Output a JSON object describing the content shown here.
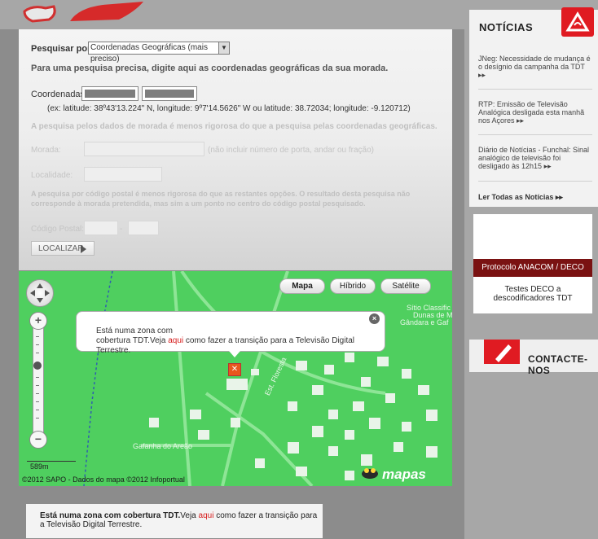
{
  "search": {
    "label": "Pesquisar por",
    "mode_value": "Coordenadas Geográficas (mais preciso)",
    "intro": "Para uma pesquisa precisa, digite aqui as coordenadas geográficas da sua morada.",
    "coords_label": "Coordenadas:",
    "coords_example": "(ex: latitude: 38º43'13.224\" N, longitude: 9º7'14.5626\" W ou latitude: 38.72034; longitude: -9.120712)",
    "address_note": "A pesquisa pelos dados de morada é menos rigorosa do que a pesquisa pelas coordenadas geográficas.",
    "morada_label": "Morada:",
    "morada_hint": "(não incluir número de porta, andar ou fração)",
    "localidade_label": "Localidade:",
    "postal_note_1": "A pesquisa por código postal é menos rigorosa do que as restantes opções. O resultado desta pesquisa não",
    "postal_note_2": "corresponde à morada pretendida, mas sim a um ponto no centro do código postal pesquisado.",
    "postal_label": "Código Postal:",
    "postal_sep": "-",
    "locate_button": "LOCALIZAR"
  },
  "map": {
    "types": [
      "Mapa",
      "Híbrido",
      "Satélite"
    ],
    "popup_line1": "Está numa zona com",
    "popup_line2_pre": "cobertura TDT.Veja ",
    "popup_link": "aqui",
    "popup_line2_post": " como fazer a transição para a Televisão Digital Terrestre.",
    "close": "×",
    "labels": {
      "sitio_1": "Sítio Classific",
      "sitio_2": "Dunas de M",
      "sitio_3": "Gândara e Gaf",
      "estrada": "Est. Floresta",
      "gafanha": "Gafanha do Areão"
    },
    "scale": "589m",
    "copyright": "©2012 SAPO - Dados do mapa ©2012 Infoportual",
    "brand": "mapas",
    "zoom_level": 0.42
  },
  "result": {
    "bold": "Está numa zona com cobertura TDT.",
    "pre": "Veja ",
    "link": "aqui",
    "post_1": " como fazer a transição para",
    "post_2": "a Televisão Digital Terrestre."
  },
  "news": {
    "title": "NOTÍCIAS",
    "items": [
      "JNeg: Necessidade de mudança é o desígnio da campanha da TDT ▸▸",
      "RTP: Emissão de Televisão Analógica desligada esta manhã nos Açores ▸▸",
      "Diário de Notícias - Funchal: Sinal analógico de televisão foi desligado às 12h15 ▸▸"
    ],
    "read_all": "Ler Todas as Notícias ▸▸"
  },
  "ad": {
    "band": "Protocolo ANACOM / DECO",
    "text_1": "Testes DECO a",
    "text_2": "descodificadores TDT"
  },
  "contact": {
    "label": "CONTACTE-NOS"
  },
  "colors": {
    "accent_red": "#e01b22",
    "map_green": "#4fcf5f",
    "link_red": "#d61d1d"
  }
}
